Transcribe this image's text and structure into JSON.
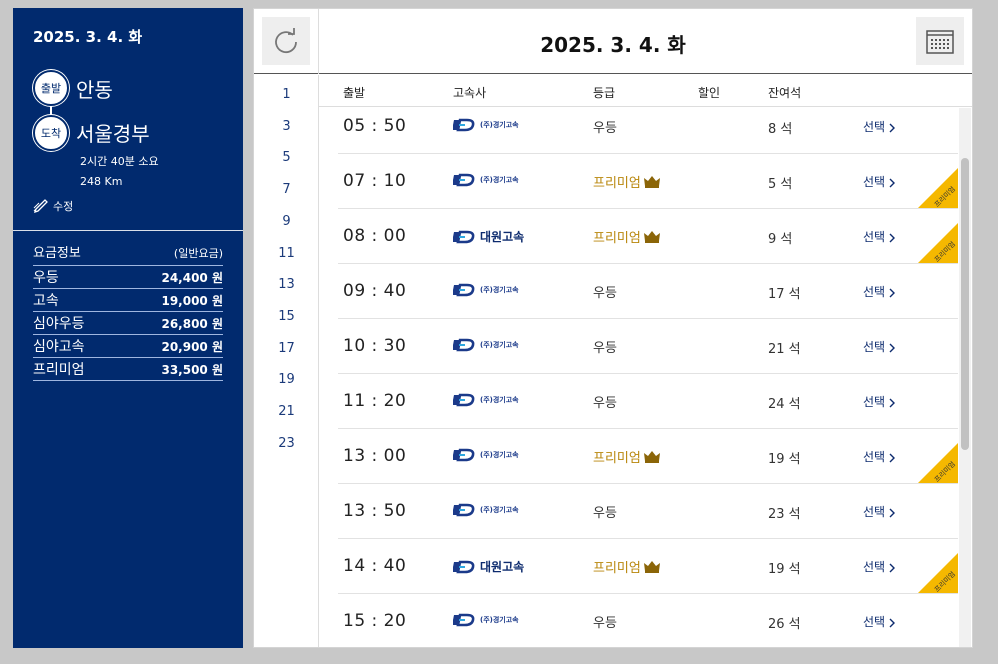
{
  "sidebar": {
    "date": "2025. 3. 4. 화",
    "departure_badge": "출발",
    "departure": "안동",
    "arrival_badge": "도착",
    "arrival": "서울경부",
    "duration": "2시간 40분 소요",
    "distance": "248 Km",
    "edit_label": "수정",
    "fare_title": "요금정보",
    "fare_note": "(일반요금)",
    "fares": [
      {
        "name": "우등",
        "price": "24,400 원"
      },
      {
        "name": "고속",
        "price": "19,000 원"
      },
      {
        "name": "심야우등",
        "price": "26,800 원"
      },
      {
        "name": "심야고속",
        "price": "20,900 원"
      },
      {
        "name": "프리미엄",
        "price": "33,500 원"
      }
    ]
  },
  "main": {
    "title": "2025. 3. 4. 화",
    "hours": [
      "1",
      "3",
      "5",
      "7",
      "9",
      "11",
      "13",
      "15",
      "17",
      "19",
      "21",
      "23"
    ],
    "columns": {
      "depart": "출발",
      "company": "고속사",
      "grade": "등급",
      "discount": "할인",
      "seats": "잔여석"
    },
    "rows": [
      {
        "time": "05 : 50",
        "company": "(주)경기고속",
        "grade": "우등",
        "seats": "8 석",
        "select": "선택",
        "premium": false
      },
      {
        "time": "07 : 10",
        "company": "(주)경기고속",
        "grade": "프리미엄",
        "seats": "5 석",
        "select": "선택",
        "premium": true
      },
      {
        "time": "08 : 00",
        "company": "대원고속",
        "grade": "프리미엄",
        "seats": "9 석",
        "select": "선택",
        "premium": true
      },
      {
        "time": "09 : 40",
        "company": "(주)경기고속",
        "grade": "우등",
        "seats": "17 석",
        "select": "선택",
        "premium": false
      },
      {
        "time": "10 : 30",
        "company": "(주)경기고속",
        "grade": "우등",
        "seats": "21 석",
        "select": "선택",
        "premium": false
      },
      {
        "time": "11 : 20",
        "company": "(주)경기고속",
        "grade": "우등",
        "seats": "24 석",
        "select": "선택",
        "premium": false
      },
      {
        "time": "13 : 00",
        "company": "(주)경기고속",
        "grade": "프리미엄",
        "seats": "19 석",
        "select": "선택",
        "premium": true
      },
      {
        "time": "13 : 50",
        "company": "(주)경기고속",
        "grade": "우등",
        "seats": "23 석",
        "select": "선택",
        "premium": false
      },
      {
        "time": "14 : 40",
        "company": "대원고속",
        "grade": "프리미엄",
        "seats": "19 석",
        "select": "선택",
        "premium": true
      },
      {
        "time": "15 : 20",
        "company": "(주)경기고속",
        "grade": "우등",
        "seats": "26 석",
        "select": "선택",
        "premium": false
      }
    ],
    "ribbon_label": "프리미엄"
  },
  "icons": {
    "refresh": "refresh-icon",
    "calendar": "calendar-icon",
    "edit": "edit-icon",
    "crown": "crown-icon",
    "chevron": "chevron-right-icon",
    "logo": "bus-company-logo-icon"
  },
  "colors": {
    "sidebar_bg": "#012a6e",
    "premium": "#b8860b",
    "ribbon": "#f5b800",
    "link": "#0d2b6e"
  }
}
